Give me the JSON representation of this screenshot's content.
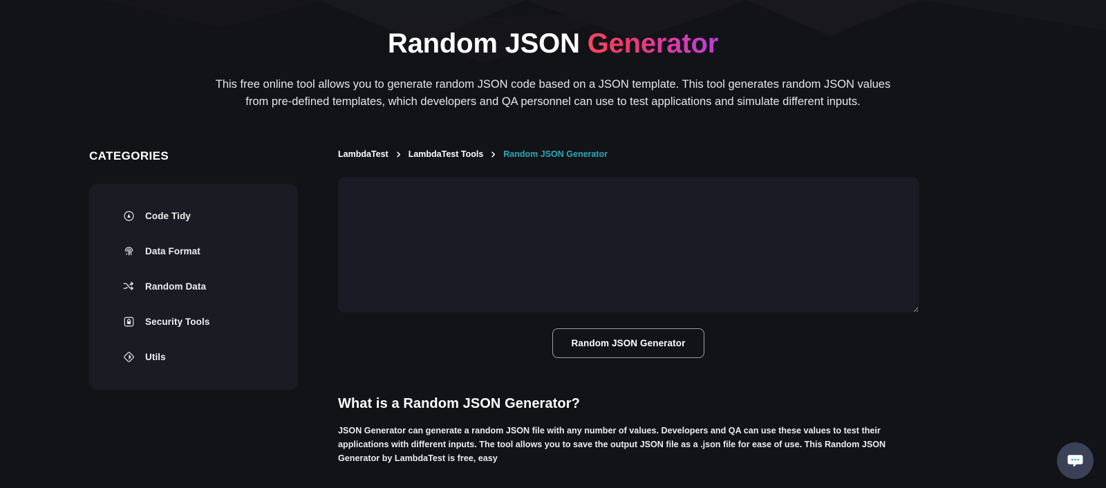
{
  "hero": {
    "title_plain": "Random JSON ",
    "title_accent": "Generator",
    "subtitle": "This free online tool allows you to generate random JSON code based on a JSON template. This tool generates random JSON values from pre-defined templates, which developers and QA personnel can use to test applications and simulate different inputs."
  },
  "sidebar": {
    "heading": "CATEGORIES",
    "items": [
      {
        "label": "Code Tidy",
        "icon": "code-tidy-icon"
      },
      {
        "label": "Data Format",
        "icon": "fingerprint-icon"
      },
      {
        "label": "Random Data",
        "icon": "shuffle-icon"
      },
      {
        "label": "Security Tools",
        "icon": "lock-icon"
      },
      {
        "label": "Utils",
        "icon": "diamond-icon"
      }
    ]
  },
  "breadcrumb": {
    "items": [
      {
        "label": "LambdaTest",
        "current": false
      },
      {
        "label": "LambdaTest Tools",
        "current": false
      },
      {
        "label": "Random JSON Generator",
        "current": true
      }
    ],
    "separator": "chevron-right-icon"
  },
  "editor": {
    "value": "",
    "placeholder": ""
  },
  "actions": {
    "generate_label": "Random JSON Generator"
  },
  "article": {
    "title": "What is a Random JSON Generator?",
    "body": "JSON Generator can generate a random JSON file with any number of values. Developers and QA can use these values to test their applications with different inputs. The tool allows you to save the output JSON file as a .json file for ease of use. This Random JSON Generator by LambdaTest is free, easy"
  },
  "chat": {
    "icon": "chat-bubble-icon",
    "label": "Open chat"
  },
  "colors": {
    "page_bg": "#121317",
    "card_bg": "#1a1b23",
    "editor_bg": "#1a1b25",
    "accent_start": "#f8475e",
    "accent_end": "#b83fd4",
    "breadcrumb_current": "#2aa9b8",
    "chat_bg": "#3b4257",
    "chat_dots": "#2aa9b8"
  }
}
